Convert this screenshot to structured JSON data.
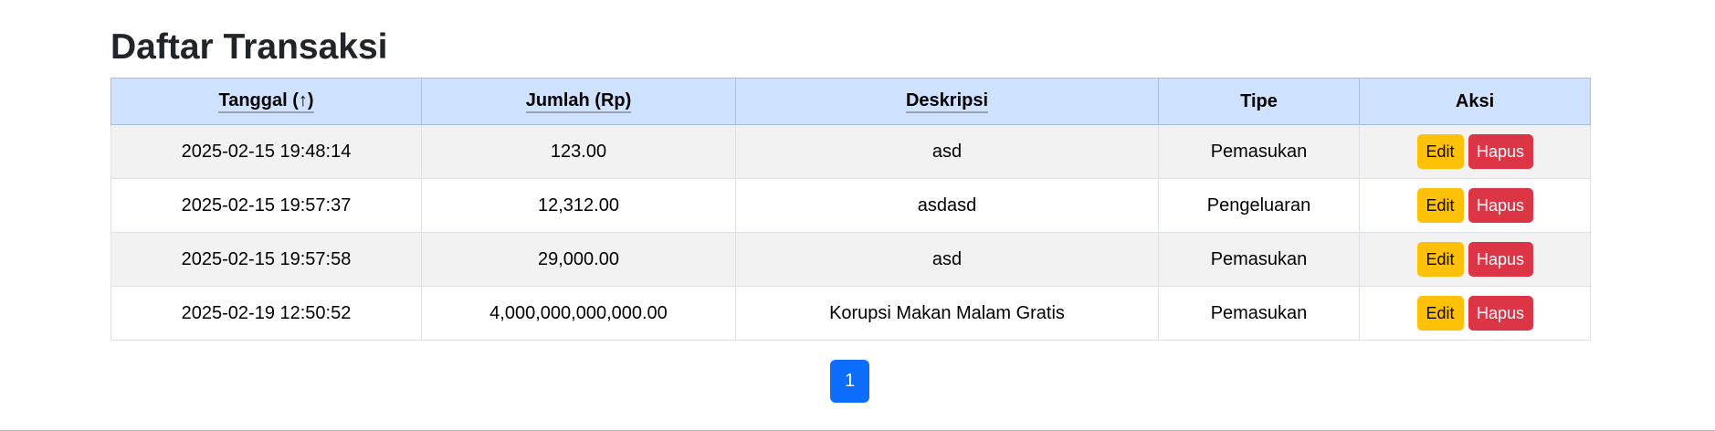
{
  "page": {
    "title": "Daftar Transaksi"
  },
  "table": {
    "headers": {
      "date": "Tanggal (↑)",
      "amount": "Jumlah (Rp)",
      "description": "Deskripsi",
      "type": "Tipe",
      "actions": "Aksi"
    },
    "rows": [
      {
        "date": "2025-02-15 19:48:14",
        "amount": "123.00",
        "description": "asd",
        "type": "Pemasukan"
      },
      {
        "date": "2025-02-15 19:57:37",
        "amount": "12,312.00",
        "description": "asdasd",
        "type": "Pengeluaran"
      },
      {
        "date": "2025-02-15 19:57:58",
        "amount": "29,000.00",
        "description": "asd",
        "type": "Pemasukan"
      },
      {
        "date": "2025-02-19 12:50:52",
        "amount": "4,000,000,000,000.00",
        "description": "Korupsi Makan Malam Gratis",
        "type": "Pemasukan"
      }
    ],
    "edit_label": "Edit",
    "delete_label": "Hapus"
  },
  "pagination": {
    "current_page": "1"
  },
  "colors": {
    "header_bg": "#cfe2ff",
    "edit_button": "#ffc107",
    "delete_button": "#dc3545",
    "page_button": "#0d6efd"
  }
}
